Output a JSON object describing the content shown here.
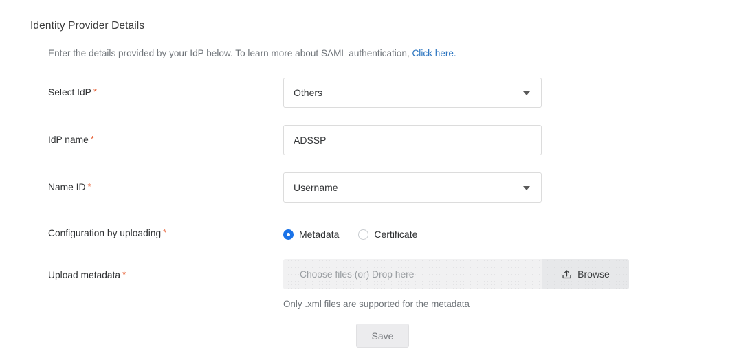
{
  "section": {
    "title": "Identity Provider Details",
    "description_prefix": "Enter the details provided by your IdP below. To learn more about SAML authentication, ",
    "description_link": "Click here.",
    "link_color": "#2a74c0"
  },
  "required_marker": "*",
  "fields": {
    "select_idp": {
      "label": "Select IdP",
      "value": "Others",
      "icon": "chevron-down-icon"
    },
    "idp_name": {
      "label": "IdP name",
      "value": "ADSSP",
      "placeholder": ""
    },
    "name_id": {
      "label": "Name ID",
      "value": "Username",
      "icon": "chevron-down-icon"
    },
    "configuration_by_uploading": {
      "label": "Configuration by uploading",
      "options": [
        {
          "label": "Metadata",
          "selected": true
        },
        {
          "label": "Certificate",
          "selected": false
        }
      ],
      "selected_color": "#1a73e8"
    },
    "upload_metadata": {
      "label": "Upload metadata",
      "drop_placeholder": "Choose files (or) Drop here",
      "browse_label": "Browse",
      "browse_icon": "upload-icon",
      "hint": "Only .xml files are supported for the metadata"
    }
  },
  "footer": {
    "save_label": "Save"
  }
}
